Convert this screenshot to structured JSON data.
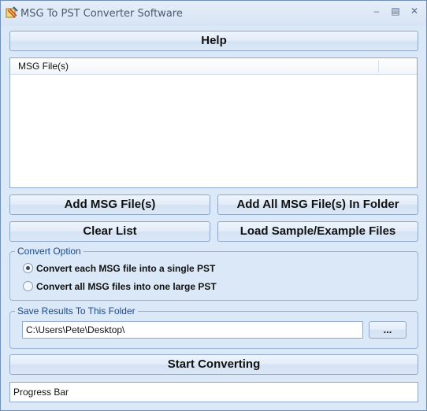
{
  "window": {
    "title": "MSG To PST Converter Software"
  },
  "toolbar": {
    "help_label": "Help"
  },
  "file_list": {
    "column_header": "MSG File(s)"
  },
  "actions": {
    "add_files_label": "Add MSG File(s)",
    "add_folder_label": "Add All MSG File(s) In Folder",
    "clear_list_label": "Clear List",
    "load_sample_label": "Load Sample/Example Files"
  },
  "convert_option": {
    "legend": "Convert Option",
    "options": [
      {
        "label": "Convert each MSG file into a single PST",
        "selected": true
      },
      {
        "label": "Convert all MSG files into one large PST",
        "selected": false
      }
    ]
  },
  "save_folder": {
    "legend": "Save Results To This Folder",
    "path": "C:\\Users\\Pete\\Desktop\\",
    "browse_label": "..."
  },
  "start_label": "Start Converting",
  "progress": {
    "text": "Progress Bar"
  }
}
